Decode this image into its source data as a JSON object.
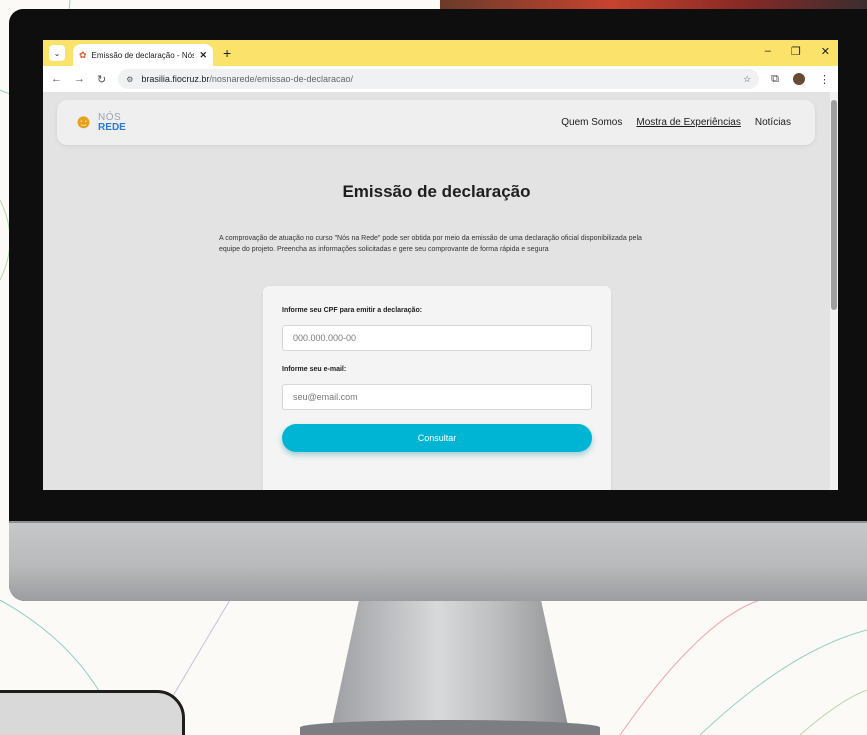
{
  "browser": {
    "tab_title": "Emissão de declaração - Nós N",
    "tab_favicon": "nos-na-rede-favicon",
    "url_host": "brasilia.fiocruz.br",
    "url_path": "/nosnarede/emissao-de-declaracao/"
  },
  "site": {
    "logo_nos": "NÓS",
    "logo_rede": "REDE",
    "nav": [
      "Quem Somos",
      "Mostra de Experiências",
      "Notícias"
    ]
  },
  "main": {
    "title": "Emissão de declaração",
    "intro": "A comprovação de atuação no curso \"Nós na Rede\" pode ser obtida por meio da emissão de uma declaração oficial disponibilizada pela equipe do projeto. Preencha as informações solicitadas e gere seu comprovante de forma rápida e segura"
  },
  "form": {
    "cpf_label": "Informe seu CPF para emitir a declaração:",
    "cpf_placeholder": "000.000.000-00",
    "email_label": "Informe seu e-mail:",
    "email_placeholder": "seu@email.com",
    "submit_label": "Consultar"
  },
  "colors": {
    "tab_bar": "#fbe36b",
    "accent": "#00b5d4",
    "rede_blue": "#2a7bd4"
  }
}
